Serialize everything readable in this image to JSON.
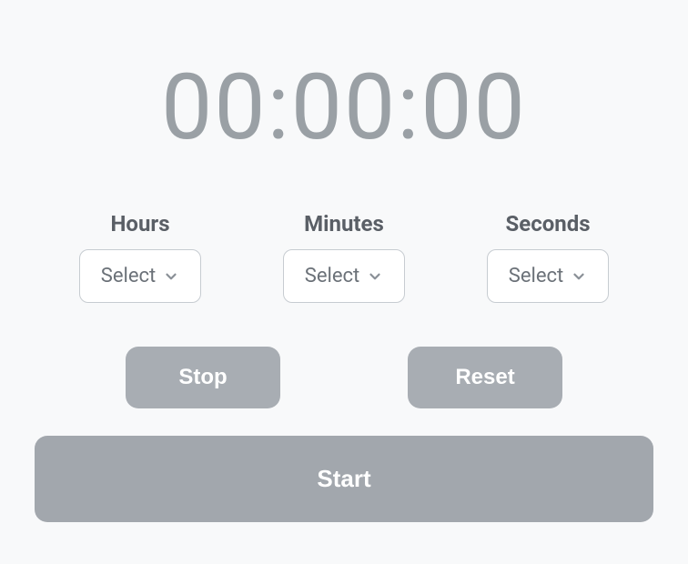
{
  "timer": {
    "display": "00:00:00"
  },
  "selectors": {
    "hours": {
      "label": "Hours",
      "selected": "Select"
    },
    "minutes": {
      "label": "Minutes",
      "selected": "Select"
    },
    "seconds": {
      "label": "Seconds",
      "selected": "Select"
    }
  },
  "buttons": {
    "stop": "Stop",
    "reset": "Reset",
    "start": "Start"
  },
  "colors": {
    "background": "#f8f9fa",
    "display_text": "#9aa0a5",
    "label_text": "#5a5f66",
    "select_text": "#6b7178",
    "select_border": "#c7ccd1",
    "button_bg": "#a8adb3",
    "large_button_bg": "#a2a7ad",
    "button_text": "#ffffff"
  }
}
